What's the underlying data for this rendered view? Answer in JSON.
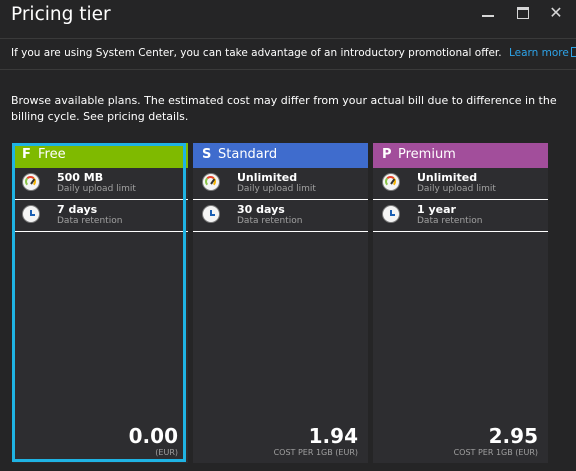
{
  "window": {
    "title": "Pricing tier",
    "minimize_icon": "minimize-icon",
    "maximize_icon": "maximize-icon",
    "close_glyph": "✕"
  },
  "info_bar": {
    "text": "If you are using System Center, you can take advantage of an introductory promotional offer.",
    "link": "Learn more",
    "link_icon": "external-link-icon",
    "link_color": "#2ea3e8"
  },
  "intro": {
    "text": "Browse available plans. The estimated cost may differ from your actual bill due to difference in the billing cycle. See pricing details."
  },
  "plans": [
    {
      "letter": "F",
      "name": "Free",
      "header_color": "#7fba00",
      "selected": true,
      "features": [
        {
          "icon": "gauge-icon",
          "value": "500 MB",
          "label": "Daily upload limit"
        },
        {
          "icon": "clock-icon",
          "value": "7 days",
          "label": "Data retention"
        }
      ],
      "price": "0.00",
      "price_note": "(EUR)"
    },
    {
      "letter": "S",
      "name": "Standard",
      "header_color": "#3f6ccd",
      "selected": false,
      "features": [
        {
          "icon": "gauge-icon",
          "value": "Unlimited",
          "label": "Daily upload limit"
        },
        {
          "icon": "clock-icon",
          "value": "30 days",
          "label": "Data retention"
        }
      ],
      "price": "1.94",
      "price_note": "COST PER 1GB (EUR)"
    },
    {
      "letter": "P",
      "name": "Premium",
      "header_color": "#a24e9b",
      "selected": false,
      "features": [
        {
          "icon": "gauge-icon",
          "value": "Unlimited",
          "label": "Daily upload limit"
        },
        {
          "icon": "clock-icon",
          "value": "1 year",
          "label": "Data retention"
        }
      ],
      "price": "2.95",
      "price_note": "COST PER 1GB (EUR)"
    }
  ],
  "colors": {
    "background": "#252526",
    "card_background": "#2d2d30",
    "selection_border": "#1fb3e3",
    "muted_text": "#a0a0a0"
  }
}
